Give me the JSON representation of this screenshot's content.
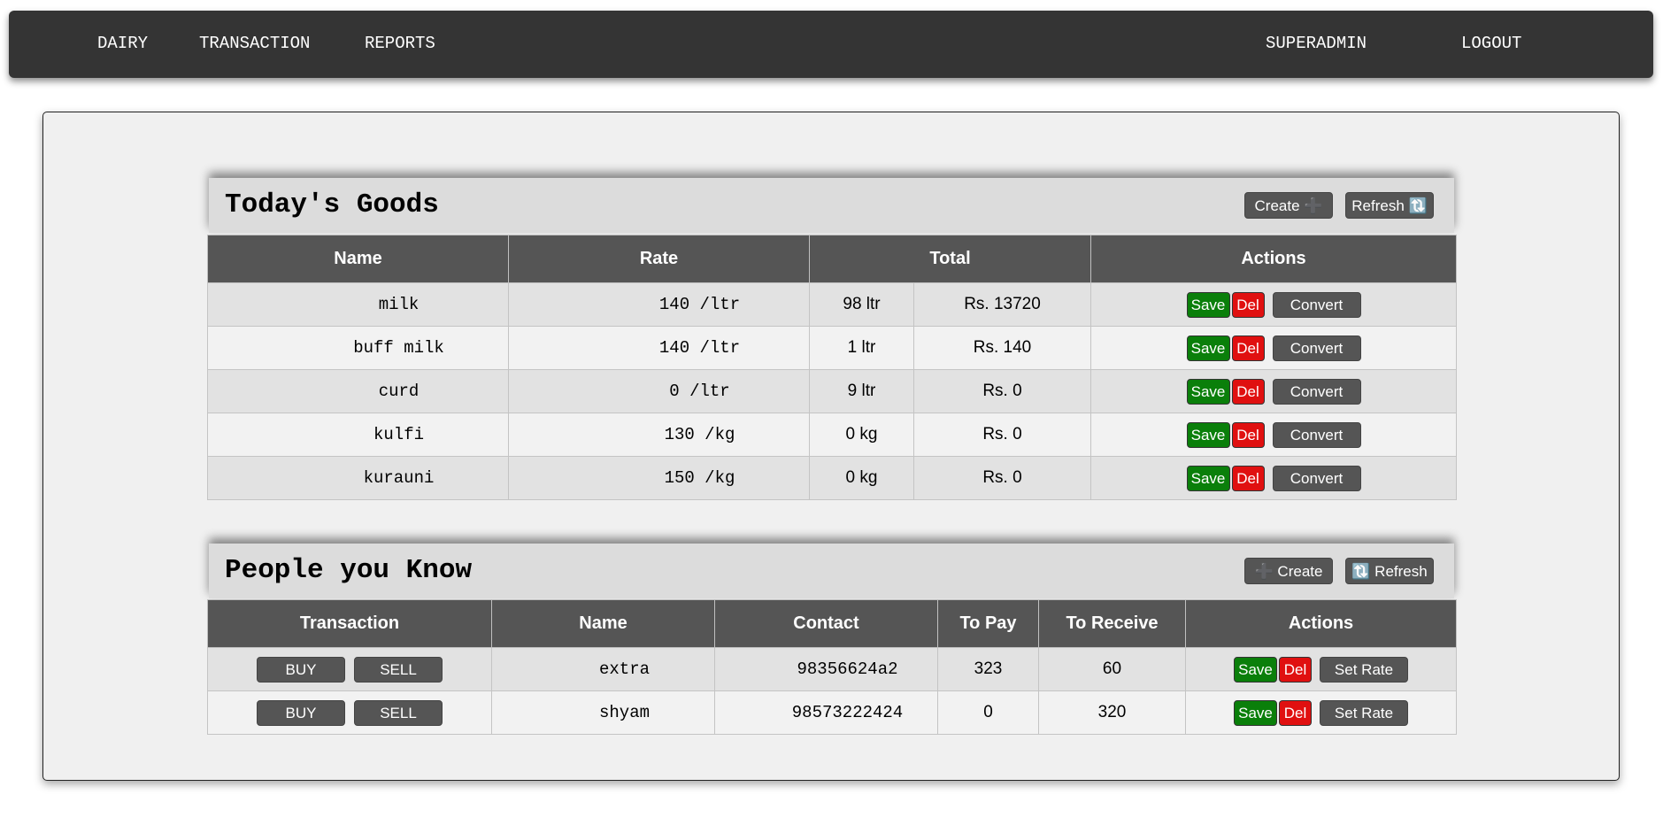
{
  "nav": {
    "items": [
      "DAIRY",
      "TRANSACTION",
      "REPORTS"
    ],
    "user": "SUPERADMIN",
    "logout": "LOGOUT"
  },
  "goods": {
    "title": "Today's Goods",
    "create_label": "Create ➕",
    "refresh_label": "Refresh 🔃",
    "columns": [
      "Name",
      "Rate",
      "Total",
      "Actions"
    ],
    "rows": [
      {
        "name": "milk",
        "rate": "140 /ltr",
        "qty": "98 ltr",
        "amount": "Rs. 13720"
      },
      {
        "name": "buff milk",
        "rate": "140 /ltr",
        "qty": "1 ltr",
        "amount": "Rs. 140"
      },
      {
        "name": "curd",
        "rate": "0 /ltr",
        "qty": "9 ltr",
        "amount": "Rs. 0"
      },
      {
        "name": "kulfi",
        "rate": "130 /kg",
        "qty": "0 kg",
        "amount": "Rs. 0"
      },
      {
        "name": "kurauni",
        "rate": "150 /kg",
        "qty": "0 kg",
        "amount": "Rs. 0"
      }
    ],
    "actions": {
      "save": "Save",
      "del": "Del",
      "convert": "Convert"
    }
  },
  "people": {
    "title": "People you Know",
    "create_label": "➕ Create",
    "refresh_label": "🔃 Refresh",
    "columns": [
      "Transaction",
      "Name",
      "Contact",
      "To Pay",
      "To Receive",
      "Actions"
    ],
    "rows": [
      {
        "name": "extra",
        "contact": "98356624a2",
        "to_pay": "323",
        "to_receive": "60"
      },
      {
        "name": "shyam",
        "contact": "98573222424",
        "to_pay": "0",
        "to_receive": "320"
      }
    ],
    "transaction": {
      "buy": "BUY",
      "sell": "SELL"
    },
    "actions": {
      "save": "Save",
      "del": "Del",
      "set_rate": "Set Rate"
    }
  }
}
